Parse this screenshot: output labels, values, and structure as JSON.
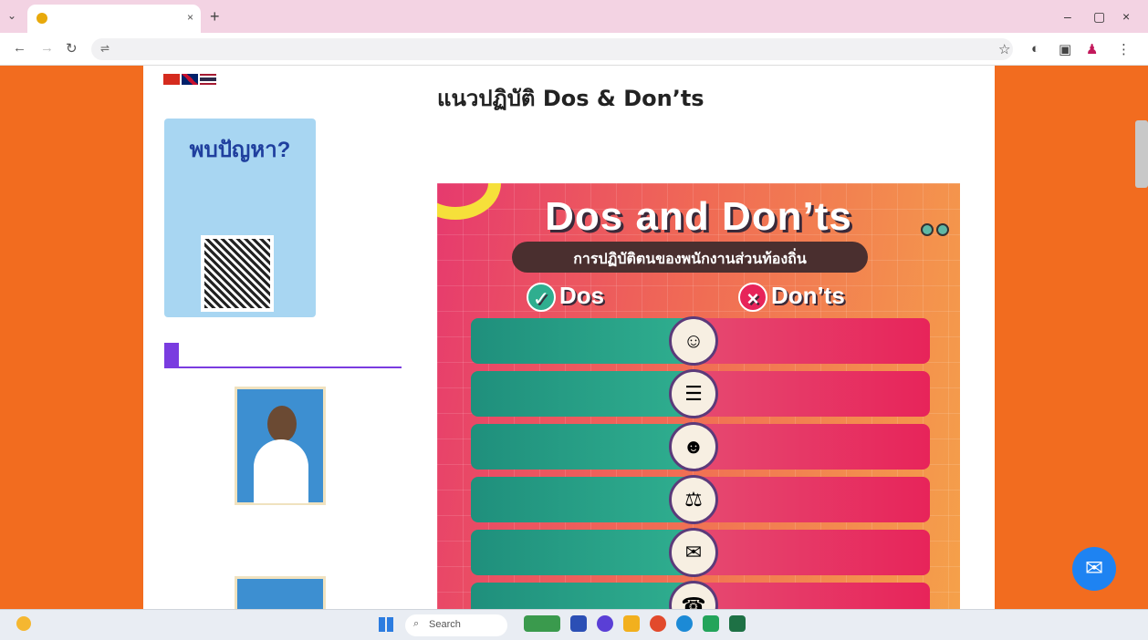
{
  "browser": {
    "tab_title": "",
    "url": "",
    "tab_menu_glyph": "⌄",
    "tab_close_glyph": "×",
    "new_tab_glyph": "+",
    "window_controls": [
      "–",
      "▢",
      "×"
    ],
    "nav": {
      "back_glyph": "←",
      "forward_glyph": "→",
      "reload_glyph": "↻"
    },
    "url_icon_glyph": "⇌",
    "toolbar_icons": [
      "☆",
      "◐",
      "▣",
      "♟",
      "⋮"
    ]
  },
  "sidebar": {
    "qr_card": {
      "line1": "",
      "line2": "พบปัญหา?",
      "line3": "",
      "line1_color": "#333333",
      "line2_color": "#1f3f9e",
      "line3_color": "#e43b2a"
    },
    "admin_heading": "",
    "admin_name": "",
    "admin_position": "",
    "admin_phone": ""
  },
  "article": {
    "title": "แนวปฏิบัติ Dos & Don’ts",
    "meta": "",
    "intro": ""
  },
  "infographic": {
    "title": "Dos and Don’ts",
    "subtitle": "การปฏิบัติตนของพนักงานส่วนท้องถิ่น",
    "dos_heading": "Dos",
    "donts_heading": "Don’ts",
    "dos_badge_glyph": "✓",
    "donts_badge_glyph": "×",
    "rows": [
      {
        "do": "",
        "dont": "",
        "icon": "☺"
      },
      {
        "do": "",
        "dont": "",
        "icon": "☰"
      },
      {
        "do": "",
        "dont": "",
        "icon": "☻"
      },
      {
        "do": "",
        "dont": "",
        "icon": "⚖"
      },
      {
        "do": "",
        "dont": "",
        "icon": "✉"
      },
      {
        "do": "",
        "dont": "",
        "icon": "☎"
      }
    ],
    "colors": {
      "do": "#1f8f7c",
      "dont": "#e7245a",
      "accent_yellow": "#f6e03a"
    }
  },
  "os": {
    "watermark": "",
    "messenger_glyph": "✉",
    "weather_temp": "",
    "weather_desc": "",
    "search_placeholder": "Search",
    "search_glyph": "⌕",
    "tray_icons": "",
    "clock_time": "",
    "clock_date": ""
  },
  "colors": {
    "page_bg": "#f26c1f",
    "tab_strip": "#f3d3e3",
    "admin_purple": "#7a3ce0",
    "messenger_blue": "#1e83f2"
  }
}
